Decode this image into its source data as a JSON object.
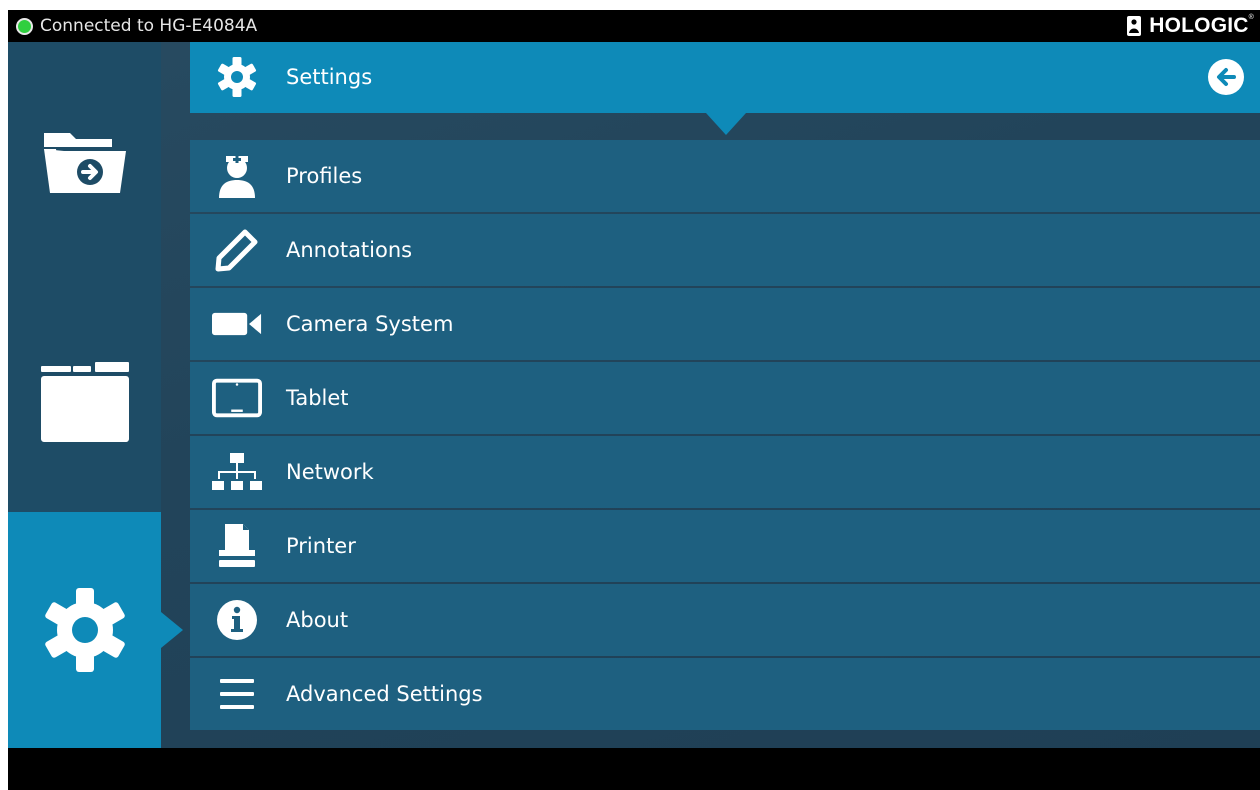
{
  "status_bar": {
    "connection_text": "Connected to HG-E4084A",
    "connection_color": "#2fcf3f",
    "brand": "HOLOGIC",
    "brand_mark": "®"
  },
  "sidebar": {
    "items": [
      {
        "name": "open-folder",
        "icon": "folder-arrow-icon"
      },
      {
        "name": "browse",
        "icon": "folder-icon"
      },
      {
        "name": "settings",
        "icon": "gear-icon",
        "active": true
      }
    ]
  },
  "header": {
    "title": "Settings",
    "icon": "gear-icon",
    "back_icon": "back-arrow-icon"
  },
  "menu": {
    "items": [
      {
        "label": "Profiles",
        "icon": "nurse-icon"
      },
      {
        "label": "Annotations",
        "icon": "pencil-icon"
      },
      {
        "label": "Camera System",
        "icon": "video-camera-icon"
      },
      {
        "label": "Tablet",
        "icon": "tablet-icon"
      },
      {
        "label": "Network",
        "icon": "network-icon"
      },
      {
        "label": "Printer",
        "icon": "printer-icon"
      },
      {
        "label": "About",
        "icon": "info-icon"
      },
      {
        "label": "Advanced Settings",
        "icon": "menu-icon"
      }
    ]
  },
  "colors": {
    "accent": "#0e8ab8",
    "sidebar": "#1e4c66",
    "menu_row": "#1e6080",
    "background": "#233f52"
  }
}
